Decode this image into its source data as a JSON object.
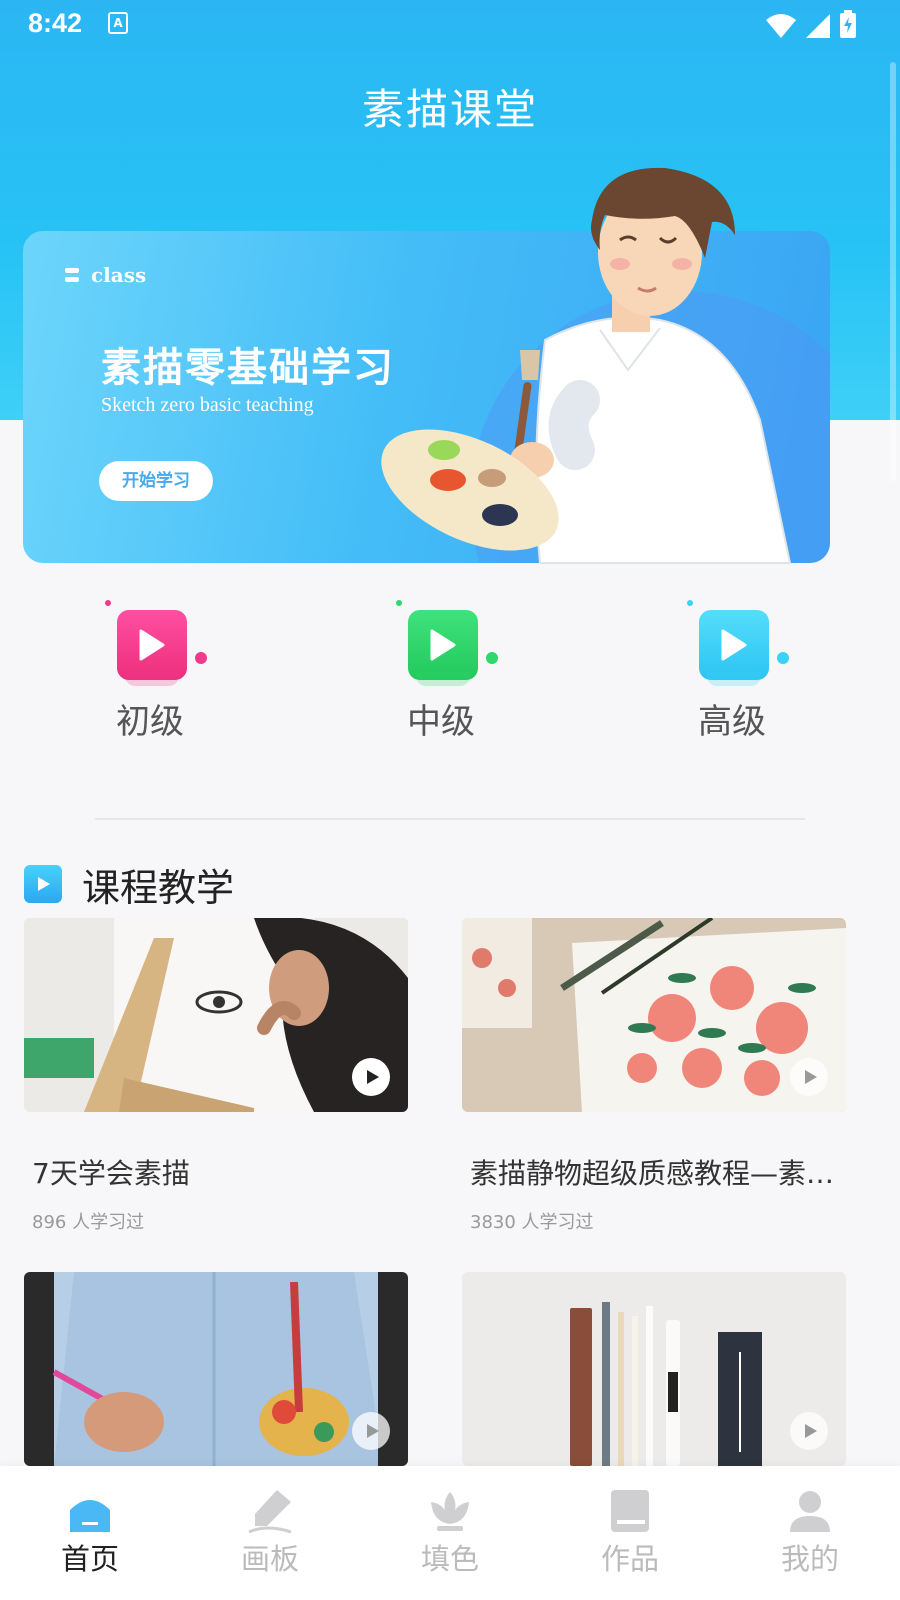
{
  "status_bar": {
    "time": "8:42",
    "notification_icon": "A"
  },
  "header": {
    "title": "素描课堂"
  },
  "banner": {
    "logo_text": "class",
    "title": "素描零基础学习",
    "subtitle": "Sketch zero basic teaching",
    "button_label": "开始学习"
  },
  "levels": [
    {
      "label": "初级",
      "color": "#f03a8c"
    },
    {
      "label": "中级",
      "color": "#2fd86b"
    },
    {
      "label": "高级",
      "color": "#3ad2f6"
    }
  ],
  "section": {
    "title": "课程教学"
  },
  "courses": [
    {
      "title": "7天学会素描",
      "meta": "896 人学习过"
    },
    {
      "title": "素描静物超级质感教程—素描石膏几何体",
      "meta": "3830 人学习过"
    },
    {
      "title": "",
      "meta": ""
    },
    {
      "title": "",
      "meta": ""
    }
  ],
  "tabbar": {
    "items": [
      {
        "label": "首页",
        "icon": "home-icon",
        "active": true
      },
      {
        "label": "画板",
        "icon": "pencil-icon",
        "active": false
      },
      {
        "label": "填色",
        "icon": "lotus-icon",
        "active": false
      },
      {
        "label": "作品",
        "icon": "book-icon",
        "active": false
      },
      {
        "label": "我的",
        "icon": "user-icon",
        "active": false
      }
    ]
  },
  "colors": {
    "accent": "#2bb6f3",
    "active_tab": "#4ab8f5"
  }
}
